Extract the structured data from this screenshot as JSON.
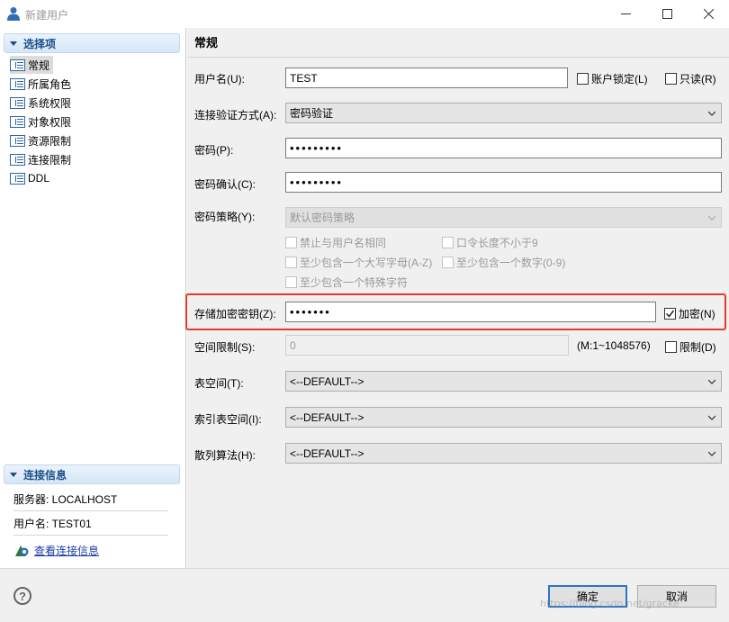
{
  "window": {
    "title": "新建用户",
    "icon": "user-icon",
    "controls": [
      "minimize-icon",
      "maximize-icon",
      "close-icon"
    ]
  },
  "sidebar": {
    "options_header": "选择项",
    "items": [
      {
        "label": "常规",
        "selected": true
      },
      {
        "label": "所属角色",
        "selected": false
      },
      {
        "label": "系统权限",
        "selected": false
      },
      {
        "label": "对象权限",
        "selected": false
      },
      {
        "label": "资源限制",
        "selected": false
      },
      {
        "label": "连接限制",
        "selected": false
      },
      {
        "label": "DDL",
        "selected": false
      }
    ],
    "connection_header": "连接信息",
    "server": "服务器: LOCALHOST",
    "username": "用户名: TEST01",
    "view_link": "查看连接信息"
  },
  "main": {
    "heading": "常规",
    "username_label": "用户名(U):",
    "username_value": "TEST",
    "account_lock_label": "账户锁定(L)",
    "readonly_label": "只读(R)",
    "auth_label": "连接验证方式(A):",
    "auth_value": "密码验证",
    "password_label": "密码(P):",
    "password_value": "•••••••••",
    "confirm_label": "密码确认(C):",
    "confirm_value": "•••••••••",
    "policy_label": "密码策略(Y):",
    "policy_value": "默认密码策略",
    "policy_options": [
      "禁止与用户名相同",
      "口令长度不小于9",
      "至少包含一个大写字母(A-Z)",
      "至少包含一个数字(0-9)",
      "至少包含一个特殊字符"
    ],
    "encrypt_key_label": "存储加密密钥(Z):",
    "encrypt_key_value": "•••••••",
    "encrypt_label": "加密(N)",
    "encrypt_checked": true,
    "space_label": "空间限制(S):",
    "space_value": "0",
    "space_range": "(M:1~1048576)",
    "limit_label": "限制(D)",
    "tablespace_label": "表空间(T):",
    "tablespace_value": "<--DEFAULT-->",
    "index_tablespace_label": "索引表空间(I):",
    "index_tablespace_value": "<--DEFAULT-->",
    "hash_label": "散列算法(H):",
    "hash_value": "<--DEFAULT-->"
  },
  "footer": {
    "help_icon": "help-icon",
    "ok_label": "确定",
    "cancel_label": "取消",
    "watermark": "https://blog.csdn.net/gracke"
  },
  "colors": {
    "highlight_frame": "#e53a2f",
    "section_header_text": "#1b4f86",
    "link": "#1a3ea8",
    "default_button_border": "#2d74c4"
  }
}
